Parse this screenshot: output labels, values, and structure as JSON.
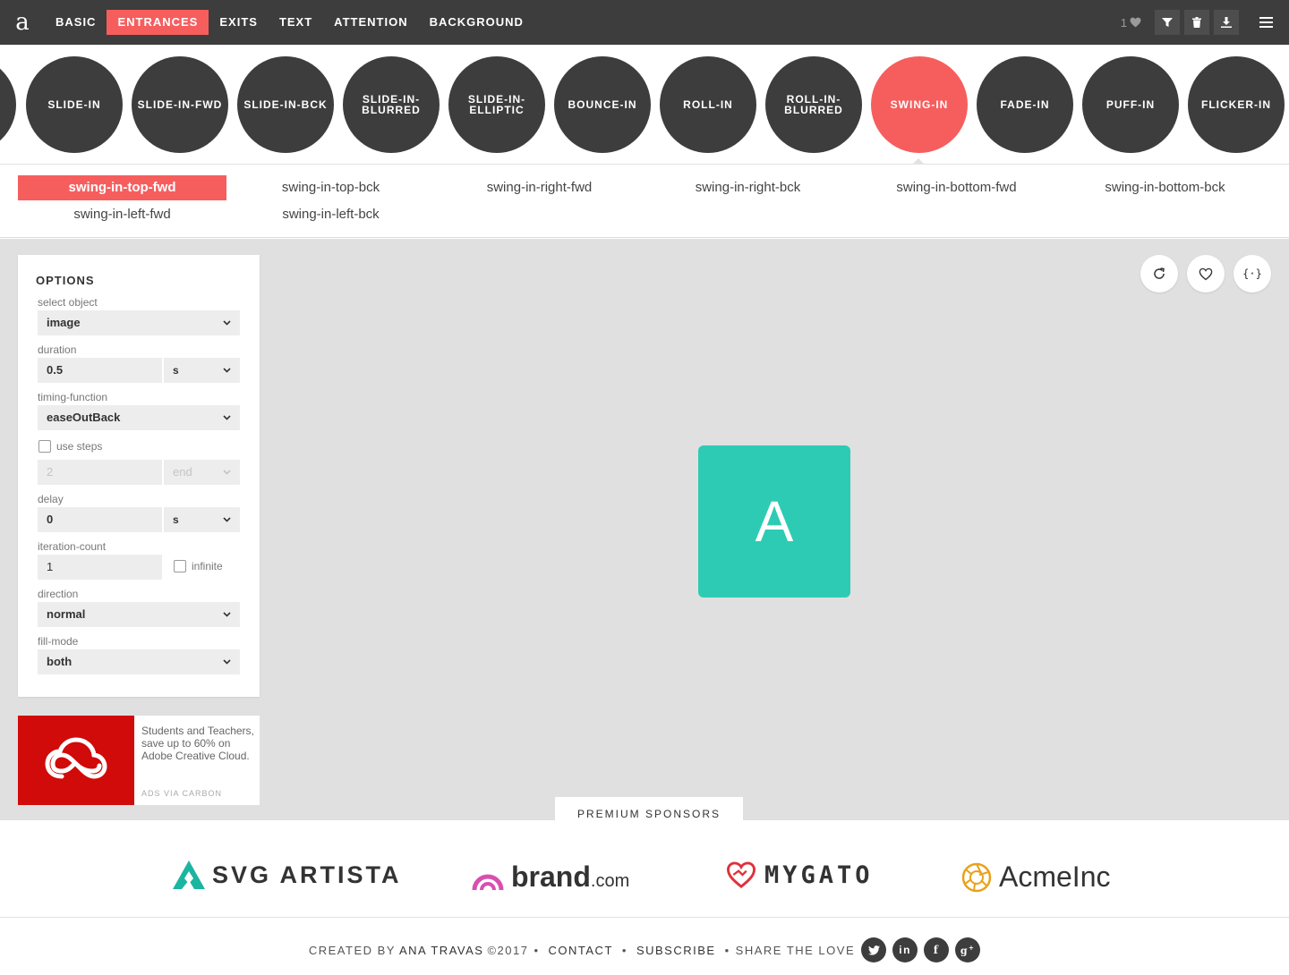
{
  "app": {
    "logo": "a"
  },
  "nav": {
    "items": [
      "BASIC",
      "ENTRANCES",
      "EXITS",
      "TEXT",
      "ATTENTION",
      "BACKGROUND"
    ],
    "active": "ENTRANCES"
  },
  "toolbar": {
    "favorites_count": "1",
    "icons": [
      "filter-icon",
      "trash-icon",
      "download-icon",
      "menu-icon"
    ]
  },
  "carousel": {
    "items": [
      {
        "label": "SLIDE-IN",
        "label2": ""
      },
      {
        "label": "SLIDE-IN-FWD",
        "label2": ""
      },
      {
        "label": "SLIDE-IN-BCK",
        "label2": ""
      },
      {
        "label": "SLIDE-IN-",
        "label2": "BLURRED"
      },
      {
        "label": "SLIDE-IN-",
        "label2": "ELLIPTIC"
      },
      {
        "label": "BOUNCE-IN",
        "label2": ""
      },
      {
        "label": "ROLL-IN",
        "label2": ""
      },
      {
        "label": "ROLL-IN-",
        "label2": "BLURRED"
      },
      {
        "label": "SWING-IN",
        "label2": ""
      },
      {
        "label": "FADE-IN",
        "label2": ""
      },
      {
        "label": "PUFF-IN",
        "label2": ""
      },
      {
        "label": "FLICKER-IN",
        "label2": ""
      }
    ],
    "active": "SWING-IN"
  },
  "variants": {
    "items": [
      "swing-in-top-fwd",
      "swing-in-top-bck",
      "swing-in-right-fwd",
      "swing-in-right-bck",
      "swing-in-bottom-fwd",
      "swing-in-bottom-bck",
      "swing-in-left-fwd",
      "swing-in-left-bck"
    ],
    "active": "swing-in-top-fwd"
  },
  "options": {
    "title": "OPTIONS",
    "select_object": {
      "label": "select object",
      "value": "image"
    },
    "duration": {
      "label": "duration",
      "value": "0.5",
      "unit": "s"
    },
    "timing_function": {
      "label": "timing-function",
      "value": "easeOutBack"
    },
    "use_steps": {
      "label": "use steps",
      "checked": false,
      "steps": "2",
      "position": "end"
    },
    "delay": {
      "label": "delay",
      "value": "0",
      "unit": "s"
    },
    "iteration_count": {
      "label": "iteration-count",
      "value": "1",
      "infinite_label": "infinite",
      "infinite": false
    },
    "direction": {
      "label": "direction",
      "value": "normal"
    },
    "fill_mode": {
      "label": "fill-mode",
      "value": "both"
    }
  },
  "ad": {
    "text": "Students and Teachers, save up to 60% on Adobe Creative Cloud.",
    "via": "ADS VIA CARBON",
    "brand_color": "#d10a0a"
  },
  "stage": {
    "demo_letter": "A",
    "demo_color": "#2ecbb4",
    "buttons": [
      "refresh-icon",
      "heart-icon",
      "code-icon"
    ],
    "code_label": "{·}"
  },
  "sponsors": {
    "tab": "PREMIUM SPONSORS",
    "items": [
      {
        "name": "SVG ARTISTA",
        "suffix": "",
        "color": "#1bb5a0"
      },
      {
        "name": "brand",
        "suffix": ".com",
        "color": "#d84fb0"
      },
      {
        "name": "MYGATO",
        "suffix": "",
        "color": "#e0313b"
      },
      {
        "name": "AcmeInc",
        "suffix": "",
        "color": "#e8a21a"
      }
    ]
  },
  "footer": {
    "created_by": "CREATED BY",
    "author": "ANA TRAVAS",
    "year": "©2017",
    "contact": "CONTACT",
    "subscribe": "SUBSCRIBE",
    "share": "SHARE THE LOVE",
    "social": [
      "twitter-icon",
      "linkedin-icon",
      "facebook-icon",
      "google-plus-icon"
    ]
  },
  "colors": {
    "accent": "#f65e5e",
    "dark": "#3d3d3d",
    "stage_bg": "#e0e0e0"
  }
}
